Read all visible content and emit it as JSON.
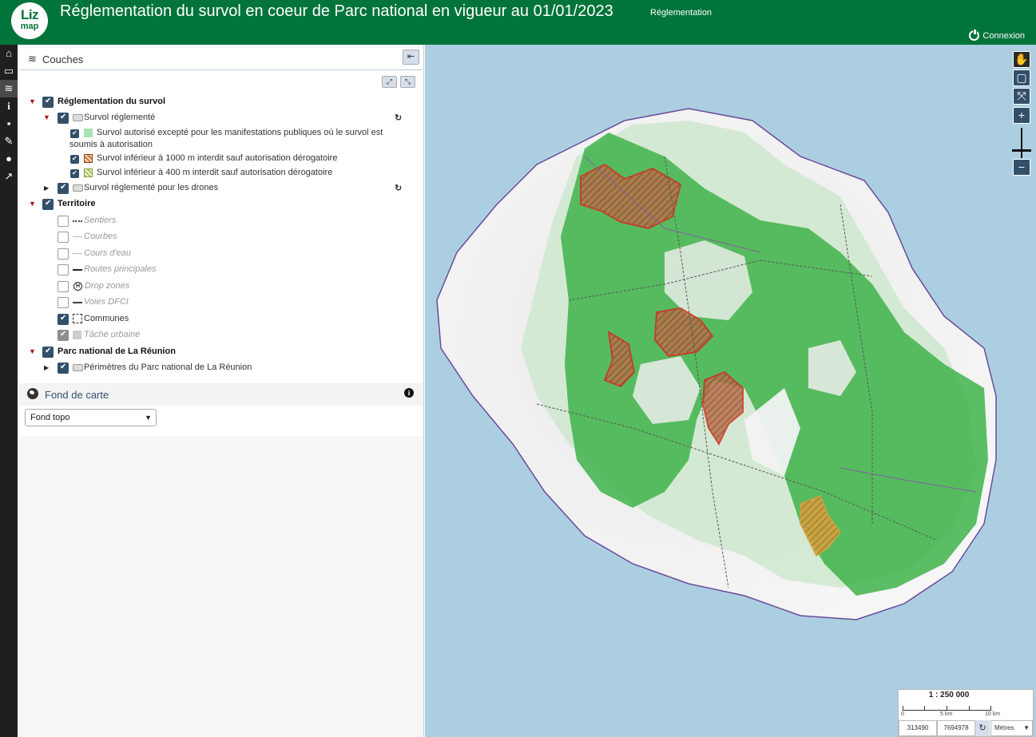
{
  "header": {
    "logo_line1": "Liz",
    "logo_line2": "map",
    "title": "Réglementation du survol en coeur de Parc national en vigueur au 01/01/2023",
    "subtitle": "Réglementation",
    "connexion_label": "Connexion"
  },
  "toolbar": {
    "items": [
      "home-icon",
      "folder-icon",
      "layers-icon",
      "info-icon",
      "comment-icon",
      "measure-icon",
      "chat-icon",
      "share-icon"
    ]
  },
  "layers": {
    "title": "Couches",
    "groups": [
      {
        "label": "Réglementation du survol"
      },
      {
        "label": "Survol réglementé"
      },
      {
        "label": "Survol autorisé excepté pour les manifestations publiques où le survol est"
      },
      {
        "label": "soumis à autorisation"
      },
      {
        "label": "Survol inférieur à 1000 m interdit sauf autorisation dérogatoire"
      },
      {
        "label": "Survol inférieur à 400 m interdit sauf autorisation dérogatoire"
      },
      {
        "label": "Survol réglementé pour les drones"
      },
      {
        "label": "Territoire"
      },
      {
        "label": "Sentiers"
      },
      {
        "label": "Courbes"
      },
      {
        "label": "Cours d'eau"
      },
      {
        "label": "Routes principales"
      },
      {
        "label": "Drop zones"
      },
      {
        "label": "Voies DFCI"
      },
      {
        "label": "Communes"
      },
      {
        "label": "Tâche urbaine"
      },
      {
        "label": "Parc national de La Réunion"
      },
      {
        "label": "Périmètres du Parc national de La Réunion"
      }
    ],
    "colors": {
      "survol_autorise": "#a8e2b0",
      "survol_1000": "#c87840",
      "survol_400": "#a8c060"
    }
  },
  "basemap": {
    "title": "Fond de carte",
    "selected": "Fond topo"
  },
  "map": {
    "scale": "1 : 250 000",
    "scale_labels": [
      "0",
      "5 km",
      "10 km"
    ],
    "coord_x": "313490",
    "coord_y": "7694978",
    "units": "Mètres"
  },
  "colors": {
    "header_bg": "#00743a",
    "accent": "#33506b",
    "sea": "#abcfe1",
    "park_green": "#3fb34a"
  }
}
